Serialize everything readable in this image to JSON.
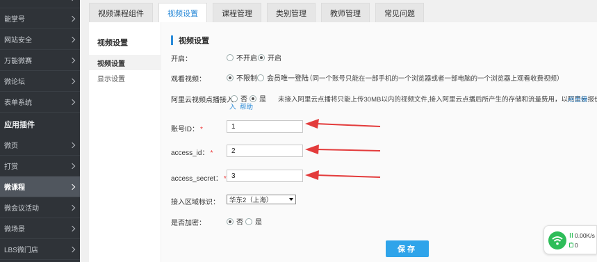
{
  "sidebar": {
    "top_items": [
      "能掌号",
      "网站安全",
      "万能微赛",
      "微论坛",
      "表单系统"
    ],
    "section_label": "应用插件",
    "plugin_items": [
      "微页",
      "打赏",
      "微课程",
      "微会议活动",
      "微场景",
      "LBS微门店"
    ],
    "active_item": "微课程"
  },
  "tabs": [
    {
      "label": "视频课程组件",
      "active": false
    },
    {
      "label": "视频设置",
      "active": true
    },
    {
      "label": "课程管理",
      "active": false
    },
    {
      "label": "类别管理",
      "active": false
    },
    {
      "label": "教师管理",
      "active": false
    },
    {
      "label": "常见问题",
      "active": false
    }
  ],
  "subnav": {
    "title": "视频设置",
    "items": [
      {
        "label": "视频设置",
        "active": true
      },
      {
        "label": "显示设置",
        "active": false
      }
    ]
  },
  "form": {
    "section_title": "视频设置",
    "enable": {
      "label": "开启：",
      "options": [
        "不开启",
        "开启"
      ],
      "selected": "开启"
    },
    "watch": {
      "label": "观看视频：",
      "options": [
        "不限制",
        "会员唯一登陆"
      ],
      "selected": "不限制",
      "note": "（同一个账号只能在一部手机的一个浏览器或者一部电脑的一个浏览器上观看收费视频）"
    },
    "aliyun": {
      "label": "阿里云视频点播接入：",
      "options": [
        "否",
        "是"
      ],
      "selected": "是",
      "note": "未接入阿里云点播将只能上传30MB以内的视频文件,接入阿里云点播后所产生的存储和流量费用，以阿里云报价为准。",
      "link_1": "点击接",
      "link_2": "入",
      "link_help": "帮助"
    },
    "account_id": {
      "label": "账号ID：",
      "required": "*",
      "value": "1"
    },
    "access_id": {
      "label": "access_id：",
      "required": "*",
      "value": "2"
    },
    "access_secret": {
      "label": "access_secret：",
      "required": "*",
      "value": "3"
    },
    "region": {
      "label": "接入区域标识：",
      "value": "华东2（上海）"
    },
    "encrypt": {
      "label": "是否加密：",
      "options": [
        "否",
        "是"
      ],
      "selected": "否"
    },
    "save_label": "保存"
  },
  "net_widget": {
    "up_speed": "0.00K/s",
    "down_count": "0",
    "accent": "#2ebd59",
    "up_icon": "up-down-arrows-icon",
    "down_icon": "battery-icon"
  },
  "colors": {
    "accent": "#2a8ad8",
    "save_button": "#2fa4ea",
    "arrow": "#e33b3b",
    "sidebar_bg": "#2f3338"
  }
}
